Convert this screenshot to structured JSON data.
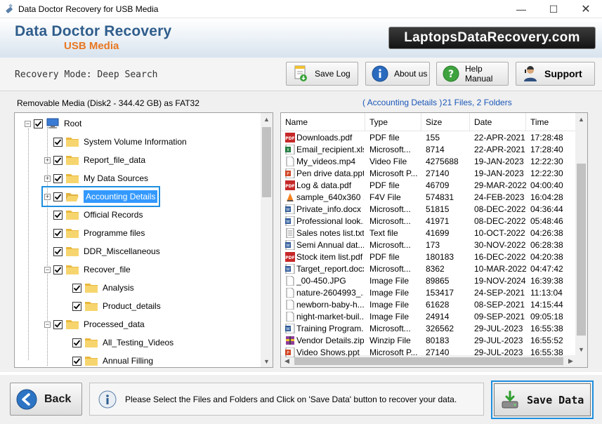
{
  "window": {
    "title": "Data Doctor Recovery for USB Media",
    "minimize": "—",
    "maximize": "☐",
    "close": "✕"
  },
  "banner": {
    "title": "Data Doctor Recovery",
    "subtitle": "USB Media",
    "site": "LaptopsDataRecovery.com"
  },
  "toolbar": {
    "mode": "Recovery Mode: Deep Search",
    "save_log": "Save Log",
    "about": "About us",
    "help": "Help Manual",
    "support": "Support"
  },
  "left": {
    "header": "Removable Media (Disk2 - 344.42 GB) as FAT32"
  },
  "right": {
    "folder": "( Accounting Details )",
    "counts": "21 Files, 2 Folders"
  },
  "tree": [
    {
      "label": "Root",
      "expander": "−",
      "level": 0,
      "root": true
    },
    {
      "label": "System Volume Information",
      "expander": "",
      "level": 1
    },
    {
      "label": "Report_file_data",
      "expander": "+",
      "level": 1
    },
    {
      "label": "My Data Sources",
      "expander": "+",
      "level": 1
    },
    {
      "label": "Accounting Details",
      "expander": "+",
      "level": 1,
      "selected": true
    },
    {
      "label": "Official Records",
      "expander": "",
      "level": 1
    },
    {
      "label": "Programme files",
      "expander": "",
      "level": 1
    },
    {
      "label": "DDR_Miscellaneous",
      "expander": "",
      "level": 1
    },
    {
      "label": "Recover_file",
      "expander": "−",
      "level": 1
    },
    {
      "label": "Analysis",
      "expander": "",
      "level": 2
    },
    {
      "label": "Product_details",
      "expander": "",
      "level": 2
    },
    {
      "label": "Processed_data",
      "expander": "−",
      "level": 1
    },
    {
      "label": "All_Testing_Videos",
      "expander": "",
      "level": 2
    },
    {
      "label": "Annual Filling",
      "expander": "",
      "level": 2
    }
  ],
  "columns": [
    "Name",
    "Type",
    "Size",
    "Date",
    "Time"
  ],
  "files": [
    {
      "name": "Downloads.pdf",
      "type": "PDF file",
      "size": "155",
      "date": "22-APR-2021",
      "time": "17:28:48",
      "icon": "pdf"
    },
    {
      "name": "Email_recipient.xlsx",
      "type": "Microsoft...",
      "size": "8714",
      "date": "22-APR-2021",
      "time": "17:28:40",
      "icon": "xls"
    },
    {
      "name": "My_videos.mp4",
      "type": "Video File",
      "size": "4275688",
      "date": "19-JAN-2023",
      "time": "12:22:30",
      "icon": "doc"
    },
    {
      "name": "Pen drive data.ppt",
      "type": "Microsoft P...",
      "size": "27140",
      "date": "19-JAN-2023",
      "time": "12:22:30",
      "icon": "ppt"
    },
    {
      "name": "Log & data.pdf",
      "type": "PDF file",
      "size": "46709",
      "date": "29-MAR-2022",
      "time": "04:00:40",
      "icon": "pdf"
    },
    {
      "name": "sample_640x360 ...",
      "type": "F4V File",
      "size": "574831",
      "date": "24-FEB-2023",
      "time": "16:04:28",
      "icon": "vlc"
    },
    {
      "name": "Private_info.docx",
      "type": "Microsoft...",
      "size": "51815",
      "date": "08-DEC-2022",
      "time": "04:36:44",
      "icon": "word"
    },
    {
      "name": "Professional look...",
      "type": "Microsoft...",
      "size": "41971",
      "date": "08-DEC-2022",
      "time": "05:48:46",
      "icon": "word"
    },
    {
      "name": "Sales notes list.txt",
      "type": "Text file",
      "size": "41699",
      "date": "10-OCT-2022",
      "time": "04:26:38",
      "icon": "txt"
    },
    {
      "name": "Semi Annual dat...",
      "type": "Microsoft...",
      "size": "173",
      "date": "30-NOV-2022",
      "time": "06:28:38",
      "icon": "word"
    },
    {
      "name": "Stock item list.pdf",
      "type": "PDF file",
      "size": "180183",
      "date": "16-DEC-2022",
      "time": "04:20:38",
      "icon": "pdf"
    },
    {
      "name": "Target_report.docx",
      "type": "Microsoft...",
      "size": "8362",
      "date": "10-MAR-2022",
      "time": "04:47:42",
      "icon": "word"
    },
    {
      "name": "_00-450.JPG",
      "type": "Image File",
      "size": "89865",
      "date": "19-NOV-2024",
      "time": "16:39:38",
      "icon": "doc"
    },
    {
      "name": "nature-2604993_...",
      "type": "Image File",
      "size": "153417",
      "date": "24-SEP-2021",
      "time": "11:13:04",
      "icon": "doc"
    },
    {
      "name": "newborn-baby-h...",
      "type": "Image File",
      "size": "61628",
      "date": "08-SEP-2021",
      "time": "14:15:44",
      "icon": "doc"
    },
    {
      "name": "night-market-buil...",
      "type": "Image File",
      "size": "24914",
      "date": "09-SEP-2021",
      "time": "09:05:18",
      "icon": "doc"
    },
    {
      "name": "Training Program...",
      "type": "Microsoft...",
      "size": "326562",
      "date": "29-JUL-2023",
      "time": "16:55:38",
      "icon": "word"
    },
    {
      "name": "Vendor Details.zip",
      "type": "Winzip File",
      "size": "80183",
      "date": "29-JUL-2023",
      "time": "16:55:52",
      "icon": "zip"
    },
    {
      "name": "Video Shows.ppt",
      "type": "Microsoft P...",
      "size": "27140",
      "date": "29-JUL-2023",
      "time": "16:55:38",
      "icon": "ppt"
    }
  ],
  "bottom": {
    "back": "Back",
    "message": "Please Select the Files and Folders and Click on 'Save Data' button to recover your data.",
    "save": "Save Data"
  },
  "colors": {
    "accent": "#1e8fe0",
    "brand_blue": "#2f5d8c",
    "brand_orange": "#e87722",
    "link_blue": "#1a56b8"
  }
}
